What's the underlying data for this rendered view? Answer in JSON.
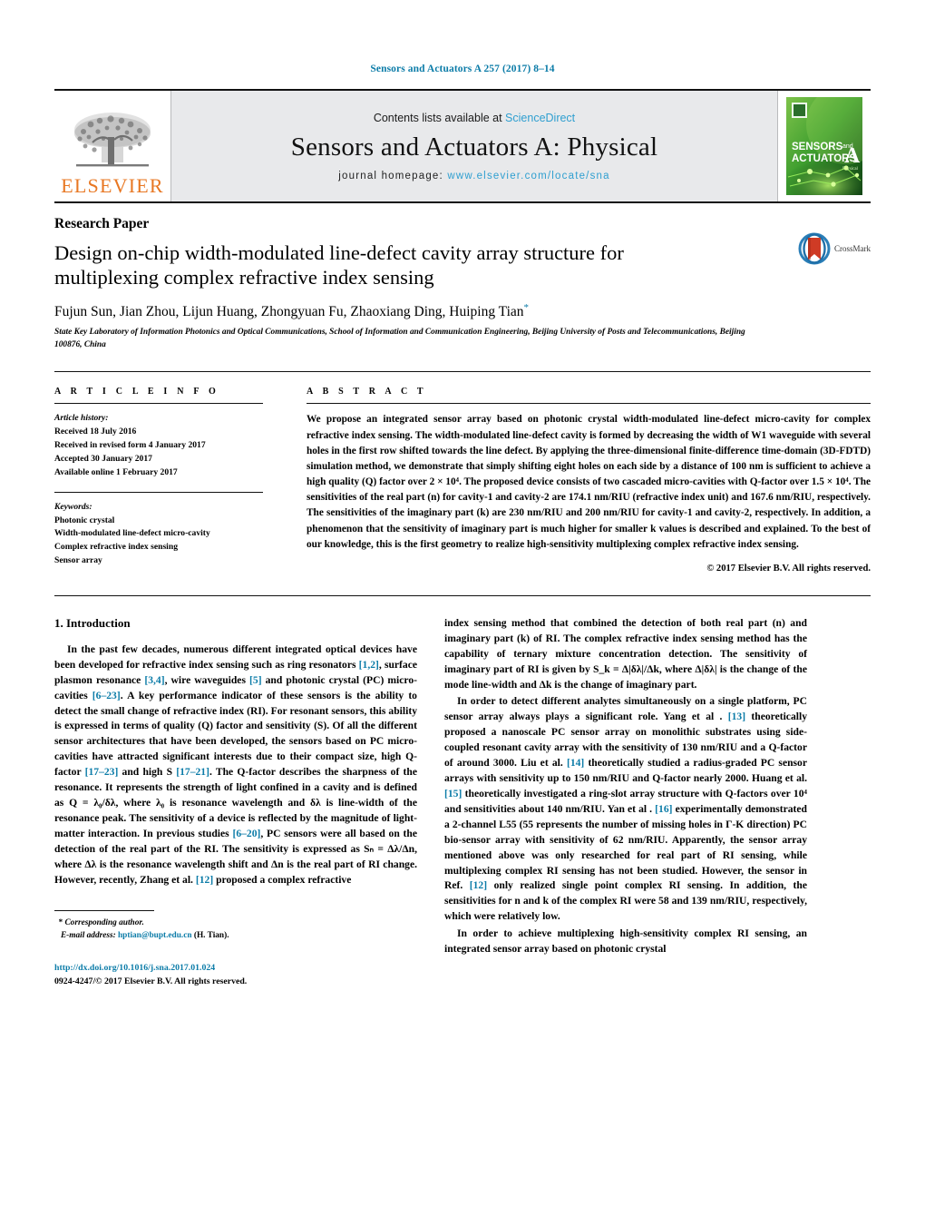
{
  "running_head": "Sensors and Actuators A 257 (2017) 8–14",
  "banner": {
    "contents_prefix": "Contents lists available at ",
    "contents_link": "ScienceDirect",
    "journal_title": "Sensors and Actuators A: Physical",
    "homepage_prefix": "journal homepage: ",
    "homepage_link": "www.elsevier.com/locate/sna",
    "publisher_logo_text": "ELSEVIER",
    "cover_line1": "SENSORS",
    "cover_and": "and",
    "cover_line2": "ACTUATORS",
    "cover_letter": "A",
    "cover_sub": "Physical"
  },
  "article": {
    "type": "Research Paper",
    "title": "Design on-chip width-modulated line-defect cavity array structure for multiplexing complex refractive index sensing",
    "authors": "Fujun Sun, Jian Zhou, Lijun Huang, Zhongyuan Fu, Zhaoxiang Ding, Huiping Tian",
    "corresponding_marker": "*",
    "affiliation": "State Key Laboratory of Information Photonics and Optical Communications, School of Information and Communication Engineering, Beijing University of Posts and Telecommunications, Beijing 100876, China",
    "crossmark_label": "CrossMark"
  },
  "article_info": {
    "heading": "A R T I C L E   I N F O",
    "history_label": "Article history:",
    "history": [
      "Received 18 July 2016",
      "Received in revised form 4 January 2017",
      "Accepted 30 January 2017",
      "Available online 1 February 2017"
    ],
    "keywords_label": "Keywords:",
    "keywords": [
      "Photonic crystal",
      "Width-modulated line-defect micro-cavity",
      "Complex refractive index sensing",
      "Sensor array"
    ]
  },
  "abstract": {
    "heading": "A B S T R A C T",
    "text": "We propose an integrated sensor array based on photonic crystal width-modulated line-defect micro-cavity for complex refractive index sensing. The width-modulated line-defect cavity is formed by decreasing the width of W1 waveguide with several holes in the first row shifted towards the line defect. By applying the three-dimensional finite-difference time-domain (3D-FDTD) simulation method, we demonstrate that simply shifting eight holes on each side by a distance of 100 nm is sufficient to achieve a high quality (Q) factor over 2 × 10⁴. The proposed device consists of two cascaded micro-cavities with Q-factor over 1.5 × 10⁴. The sensitivities of the real part (n) for cavity-1 and cavity-2 are 174.1 nm/RIU (refractive index unit) and 167.6 nm/RIU, respectively. The sensitivities of the imaginary part (k) are 230 nm/RIU and 200 nm/RIU for cavity-1 and cavity-2, respectively. In addition, a phenomenon that the sensitivity of imaginary part is much higher for smaller k values is described and explained. To the best of our knowledge, this is the first geometry to realize high-sensitivity multiplexing complex refractive index sensing.",
    "copyright": "© 2017 Elsevier B.V. All rights reserved."
  },
  "introduction": {
    "section_number": "1.",
    "section_title": "Introduction",
    "left_paragraphs": [
      "In the past few decades, numerous different integrated optical devices have been developed for refractive index sensing such as ring resonators [1,2], surface plasmon resonance [3,4], wire waveguides [5] and photonic crystal (PC) micro-cavities [6–23]. A key performance indicator of these sensors is the ability to detect the small change of refractive index (RI). For resonant sensors, this ability is expressed in terms of quality (Q) factor and sensitivity (S). Of all the different sensor architectures that have been developed, the sensors based on PC micro-cavities have attracted significant interests due to their compact size, high Q-factor [17–23] and high S [17–21]. The Q-factor describes the sharpness of the resonance. It represents the strength of light confined in a cavity and is defined as Q = λ₀/δλ, where λ₀ is resonance wavelength and δλ is line-width of the resonance peak. The sensitivity of a device is reflected by the magnitude of light-matter interaction. In previous studies [6–20], PC sensors were all based on the detection of the real part of the RI. The sensitivity is expressed as Sₙ = Δλ/Δn, where Δλ is the resonance wavelength shift and Δn is the real part of RI change. However, recently, Zhang et al. [12] proposed a complex refractive"
    ],
    "right_paragraphs": [
      "index sensing method that combined the detection of both real part (n) and imaginary part (k) of RI. The complex refractive index sensing method has the capability of ternary mixture concentration detection. The sensitivity of imaginary part of RI is given by S_k = Δ|δλ|/Δk, where Δ|δλ| is the change of the mode line-width and Δk is the change of imaginary part.",
      "In order to detect different analytes simultaneously on a single platform, PC sensor array always plays a significant role. Yang et al . [13] theoretically proposed a nanoscale PC sensor array on monolithic substrates using side-coupled resonant cavity array with the sensitivity of 130 nm/RIU and a Q-factor of around 3000. Liu et al. [14] theoretically studied a radius-graded PC sensor arrays with sensitivity up to 150 nm/RIU and Q-factor nearly 2000. Huang et al. [15] theoretically investigated a ring-slot array structure with Q-factors over 10⁴ and sensitivities about 140 nm/RIU. Yan et al . [16] experimentally demonstrated a 2-channel L55 (55 represents the number of missing holes in Γ-K direction) PC bio-sensor array with sensitivity of 62 nm/RIU. Apparently, the sensor array mentioned above was only researched for real part of RI sensing, while multiplexing complex RI sensing has not been studied. However, the sensor in Ref. [12] only realized single point complex RI sensing. In addition, the sensitivities for n and k of the complex RI were 58 and 139 nm/RIU, respectively, which were relatively low.",
      "In order to achieve multiplexing high-sensitivity complex RI sensing, an integrated sensor array based on photonic crystal"
    ]
  },
  "footer": {
    "corresponding_star": "*",
    "corresponding_label": "Corresponding author.",
    "email_label": "E-mail address:",
    "email": "hptian@bupt.edu.cn",
    "email_suffix": "(H. Tian).",
    "doi": "http://dx.doi.org/10.1016/j.sna.2017.01.024",
    "issn_line": "0924-4247/© 2017 Elsevier B.V. All rights reserved."
  },
  "colors": {
    "link": "#0c7ca8",
    "elsevier_orange": "#E87722",
    "banner_bg": "#e8e9eb"
  }
}
